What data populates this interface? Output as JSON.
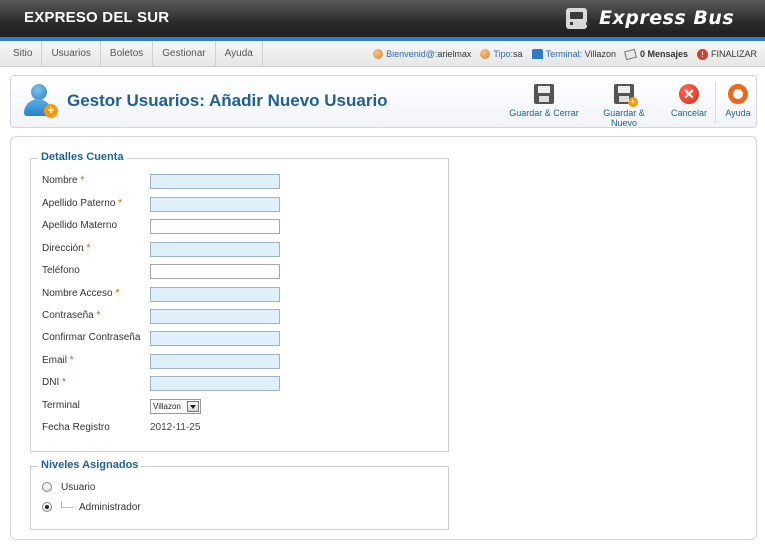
{
  "header": {
    "site_title": "EXPRESO DEL SUR",
    "logo_text": "Express Bus"
  },
  "menu": {
    "items": [
      "Sitio",
      "Usuarios",
      "Boletos",
      "Gestionar",
      "Ayuda"
    ]
  },
  "status": {
    "welcome_label": "Bienvenid@:",
    "welcome_user": "arielmax",
    "type_label": "Tipo:",
    "type_value": "sa",
    "terminal_label": "Terminal:",
    "terminal_value": "Villazon",
    "messages": "0 Mensajes",
    "logout": "FINALIZAR"
  },
  "toolbar": {
    "title": "Gestor Usuarios: Añadir Nuevo Usuario",
    "save_close": "Guardar & Cerrar",
    "save_new": "Guardar & Nuevo",
    "cancel": "Cancelar",
    "help": "Ayuda"
  },
  "account": {
    "legend": "Detalles Cuenta",
    "fields": [
      {
        "label": "Nombre",
        "required": "*"
      },
      {
        "label": "Apellido Paterno",
        "required": "*"
      },
      {
        "label": "Apellido Materno",
        "required": ""
      },
      {
        "label": "Dirección",
        "required": "*"
      },
      {
        "label": "Teléfono",
        "required": ""
      },
      {
        "label": "Nombre Acceso",
        "required": "*"
      },
      {
        "label": "Contraseña",
        "required": "*"
      },
      {
        "label": "Confirmar Contraseña",
        "required": ""
      },
      {
        "label": "Email",
        "required": "*"
      },
      {
        "label": "DNI",
        "required": "*"
      }
    ],
    "terminal_label": "Terminal",
    "terminal_selected": "Villazon",
    "date_label": "Fecha Registro",
    "date_value": "2012-11-25"
  },
  "levels": {
    "legend": "Niveles Asignados",
    "options": [
      {
        "label": "Usuario",
        "checked": false
      },
      {
        "label": "Administrador",
        "checked": true
      }
    ]
  },
  "colors": {
    "accent": "#2e7fc8",
    "title_blue": "#1f5f93",
    "required": "#e05a00",
    "input_fill": "#dff0fb"
  }
}
